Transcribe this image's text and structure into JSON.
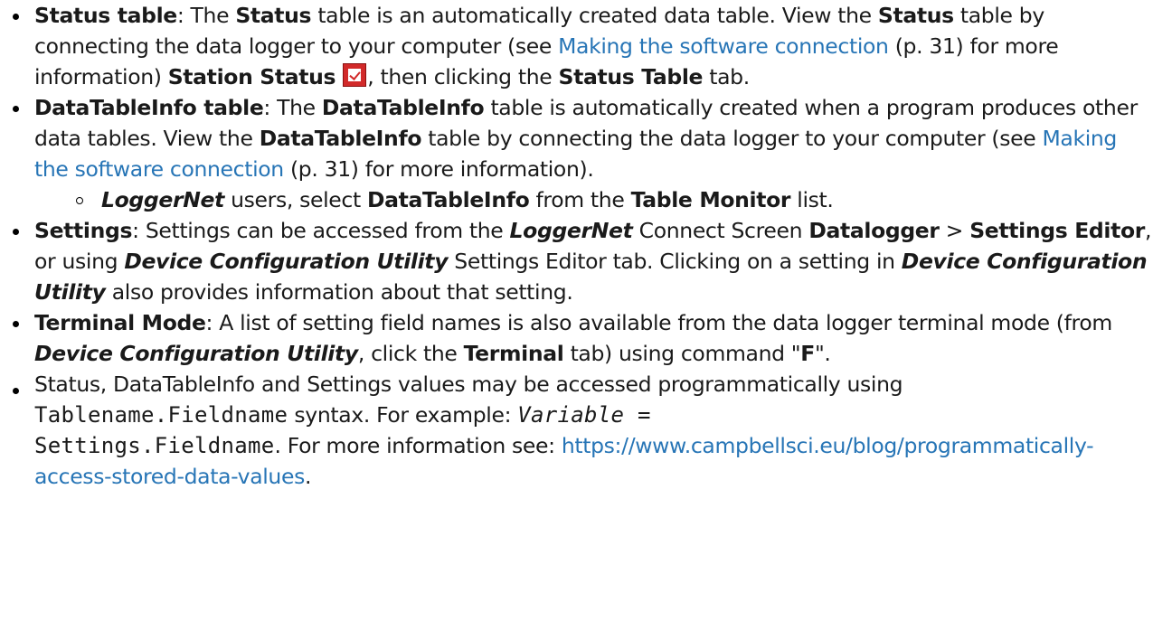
{
  "items": {
    "status": {
      "term": "Status table",
      "t1": ": The ",
      "b1": "Status",
      "t2": " table is an automatically created data table. View the ",
      "b2": "Status",
      "t3": " table by connecting the data logger to your computer (see ",
      "link": "Making the software connection",
      "t4": " (p. 31) for more information) ",
      "b3": "Station Status",
      "icon": "station-status-icon",
      "t5": ", then clicking the ",
      "b4": "Status Table",
      "t6": " tab."
    },
    "datatableinfo": {
      "term": "DataTableInfo table",
      "t1": ": The ",
      "b1": "DataTableInfo",
      "t2": " table is automatically created when a program produces other data tables. View the ",
      "b2": "DataTableInfo",
      "t3": " table by connecting the data logger to your computer (see ",
      "link": "Making the software connection",
      "t4": " (p. 31) for more information).",
      "sub": {
        "italic": "LoggerNet",
        "t1": " users, select ",
        "b1": "DataTableInfo",
        "t2": " from the ",
        "b2": "Table Monitor",
        "t3": " list."
      }
    },
    "settings": {
      "term": "Settings",
      "t1": ": Settings can be accessed from the ",
      "i1": "LoggerNet",
      "t2": " Connect Screen ",
      "b1": "Datalogger",
      "t3": " > ",
      "b2": "Settings Editor",
      "t4": ", or using ",
      "i2": "Device Configuration Utility",
      "t5": " Settings Editor tab. Clicking on a setting in ",
      "i3": "Device Configuration Utility",
      "t6": " also provides information about that setting."
    },
    "terminal": {
      "term": "Terminal Mode",
      "t1": ": A list of setting field names is also available from the data logger terminal mode (from ",
      "i1": "Device Configuration Utility",
      "t2": ", click the ",
      "b1": "Terminal",
      "t3": " tab) using command \"",
      "b2": "F",
      "t4": "\"."
    },
    "programmatic": {
      "t1": "Status, DataTableInfo and Settings values may be accessed programmatically using ",
      "code1": "Tablename.Fieldname",
      "t2": " syntax. For example: ",
      "code2": "Variable =",
      "code3": "Settings.Fieldname",
      "t3": ". For more information see: ",
      "url": "https://www.campbellsci.eu/blog/programmatically-access-stored-data-values",
      "t4": "."
    }
  },
  "colors": {
    "text": "#1a1a1a",
    "link": "#2775b6",
    "icon_red": "#d22a2a"
  }
}
